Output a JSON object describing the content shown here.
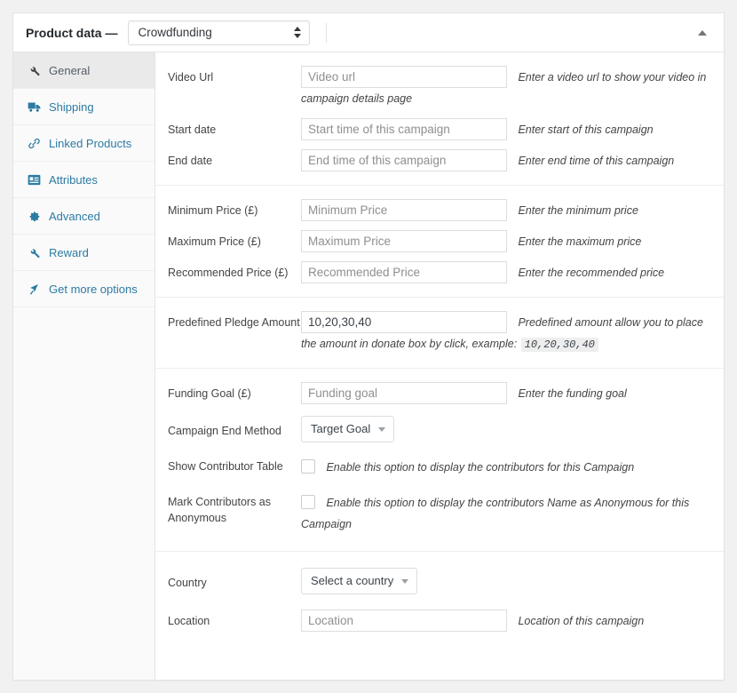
{
  "header": {
    "title": "Product data —",
    "product_type": "Crowdfunding",
    "collapse_icon": "triangle-up-icon"
  },
  "sidebar": {
    "items": [
      {
        "label": "General",
        "icon": "wrench-icon",
        "active": true
      },
      {
        "label": "Shipping",
        "icon": "truck-icon",
        "active": false
      },
      {
        "label": "Linked Products",
        "icon": "link-icon",
        "active": false
      },
      {
        "label": "Attributes",
        "icon": "attributes-icon",
        "active": false
      },
      {
        "label": "Advanced",
        "icon": "gear-icon",
        "active": false
      },
      {
        "label": "Reward",
        "icon": "wrench-icon",
        "active": false
      },
      {
        "label": "Get more options",
        "icon": "cursor-icon",
        "active": false
      }
    ]
  },
  "groups": [
    {
      "fields": [
        {
          "label": "Video Url",
          "control": "text",
          "placeholder": "Video url",
          "value": "",
          "hint": "Enter a video url to show your video in campaign details page"
        },
        {
          "label": "Start date",
          "control": "text",
          "placeholder": "Start time of this campaign",
          "value": "",
          "hint": "Enter start of this campaign"
        },
        {
          "label": "End date",
          "control": "text",
          "placeholder": "End time of this campaign",
          "value": "",
          "hint": "Enter end time of this campaign"
        }
      ]
    },
    {
      "fields": [
        {
          "label": "Minimum Price (£)",
          "control": "text",
          "placeholder": "Minimum Price",
          "value": "",
          "hint": "Enter the minimum price"
        },
        {
          "label": "Maximum Price (£)",
          "control": "text",
          "placeholder": "Maximum Price",
          "value": "",
          "hint": "Enter the maximum price"
        },
        {
          "label": "Recommended Price (£)",
          "control": "text",
          "placeholder": "Recommended Price",
          "value": "",
          "hint": "Enter the recommended price"
        }
      ]
    },
    {
      "fields": [
        {
          "label": "Predefined Pledge Amount",
          "control": "text",
          "placeholder": "",
          "value": "10,20,30,40",
          "hint": "Predefined amount allow you to place the amount in donate box by click, example:",
          "hint_code": "10,20,30,40"
        }
      ]
    },
    {
      "fields": [
        {
          "label": "Funding Goal (£)",
          "control": "text",
          "placeholder": "Funding goal",
          "value": "",
          "hint": "Enter the funding goal"
        },
        {
          "label": "Campaign End Method",
          "control": "select",
          "value": "Target Goal",
          "hint": ""
        },
        {
          "label": "Show Contributor Table",
          "control": "checkbox",
          "checked": false,
          "hint": "Enable this option to display the contributors for this Campaign"
        },
        {
          "label": "Mark Contributors as Anonymous",
          "control": "checkbox",
          "checked": false,
          "hint": "Enable this option to display the contributors Name as Anonymous for this Campaign"
        }
      ]
    },
    {
      "fields": [
        {
          "label": "Country",
          "control": "select",
          "value": "Select a country",
          "hint": ""
        },
        {
          "label": "Location",
          "control": "text",
          "placeholder": "Location",
          "value": "",
          "hint": "Location of this campaign"
        }
      ]
    }
  ],
  "colors": {
    "link": "#2b7ba2",
    "panel_border": "#e2e4e7",
    "sidebar_bg": "#fafafa",
    "active_tab_bg": "#eaeaea"
  }
}
